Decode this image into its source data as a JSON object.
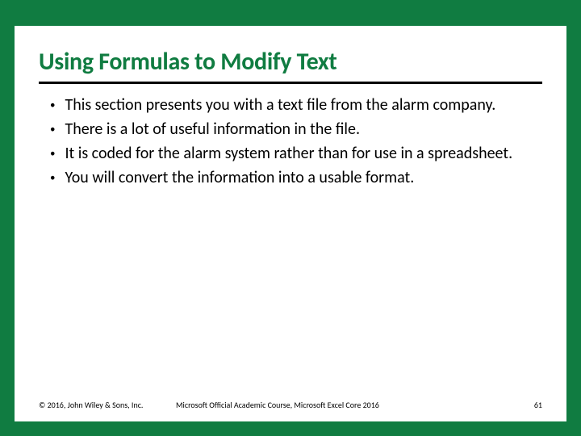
{
  "title": "Using Formulas to Modify Text",
  "bullets": [
    "This section presents you with a text file from the alarm company.",
    "There is a lot of useful information in the file.",
    "It is coded for the alarm system rather than for use in a spreadsheet.",
    "You will convert the information into a usable format."
  ],
  "footer": {
    "copyright": "© 2016, John Wiley & Sons, Inc.",
    "course": "Microsoft Official Academic Course, Microsoft Excel Core 2016",
    "page": "61"
  }
}
